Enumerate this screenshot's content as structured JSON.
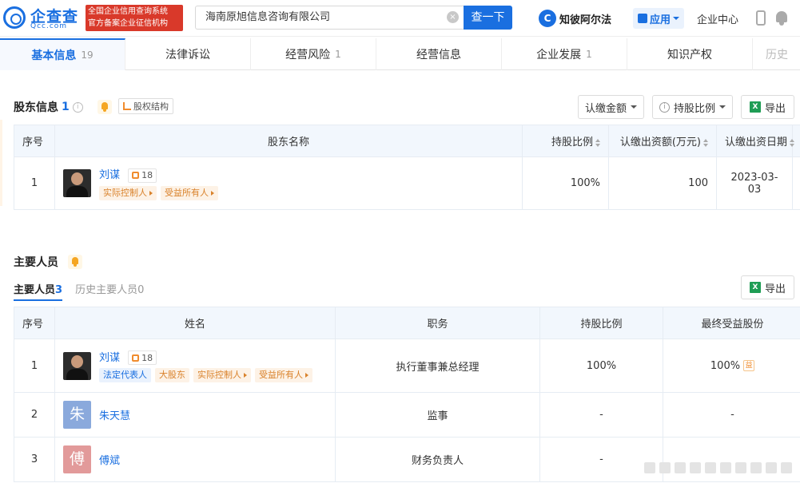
{
  "header": {
    "logo_text": "企查查",
    "logo_sub": "Qcc.com",
    "badge_line1": "全国企业信用查询系统",
    "badge_line2": "官方备案企业征信机构",
    "search_value": "海南原旭信息咨询有限公司",
    "search_button": "查一下",
    "zbfs_icon": "C",
    "zbfs_label": "知彼阿尔法",
    "app_label": "应用",
    "enterprise_center": "企业中心"
  },
  "tabs": [
    {
      "label": "基本信息",
      "count": "19"
    },
    {
      "label": "法律诉讼",
      "count": ""
    },
    {
      "label": "经营风险",
      "count": "1"
    },
    {
      "label": "经营信息",
      "count": ""
    },
    {
      "label": "企业发展",
      "count": "1"
    },
    {
      "label": "知识产权",
      "count": ""
    },
    {
      "label": "历史",
      "count": ""
    }
  ],
  "shareholders": {
    "title": "股东信息",
    "count": "1",
    "info_icon": "i",
    "equity_button": "股权结构",
    "btn_amount": "认缴金额",
    "btn_ratio_icon": "i",
    "btn_ratio": "持股比例",
    "btn_export_icon": "X",
    "btn_export": "导出",
    "columns": [
      "序号",
      "股东名称",
      "持股比例",
      "认缴出资额(万元)",
      "认缴出资日期"
    ],
    "rows": [
      {
        "no": "1",
        "name": "刘谋",
        "count": "18",
        "tags": [
          "实际控制人",
          "受益所有人"
        ],
        "ratio": "100%",
        "amount": "100",
        "date": "2023-03-03"
      }
    ]
  },
  "personnel": {
    "title": "主要人员",
    "subtab_active": "主要人员",
    "subtab_active_count": "3",
    "subtab_history": "历史主要人员",
    "subtab_history_count": "0",
    "btn_export_icon": "X",
    "btn_export": "导出",
    "columns": [
      "序号",
      "姓名",
      "职务",
      "持股比例",
      "最终受益股份"
    ],
    "rows": [
      {
        "no": "1",
        "name": "刘谋",
        "avatar": "photo",
        "count": "18",
        "role": "执行董事兼总经理",
        "ratio": "100%",
        "benefit": "100%",
        "benefit_icon": "益"
      },
      {
        "no": "2",
        "name": "朱天慧",
        "avatar": "朱",
        "avatar_color": "#8aa9dc",
        "role": "监事",
        "ratio": "-",
        "benefit": "-"
      },
      {
        "no": "3",
        "name": "傅斌",
        "avatar": "傅",
        "avatar_color": "#e29a9a",
        "role": "财务负责人",
        "ratio": "-",
        "benefit": ""
      }
    ],
    "row1_tags": [
      "法定代表人",
      "大股东",
      "实际控制人",
      "受益所有人"
    ]
  },
  "colors": {
    "accent": "#1a6fe0",
    "badge_red": "#d9392a",
    "tag_orange": "#d9822b"
  },
  "icons": [
    "search-clear-icon",
    "phone-icon",
    "bell-icon",
    "info-icon",
    "excel-icon",
    "link-icon",
    "caret-down-icon",
    "sort-icon"
  ]
}
